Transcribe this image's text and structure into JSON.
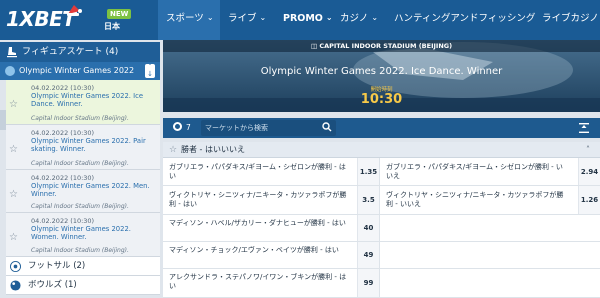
{
  "header": {
    "logo": "1XBET",
    "new_badge": "NEW",
    "language": "日本",
    "nav": [
      {
        "label": "スポーツ",
        "chevron": true
      },
      {
        "label": "ライブ",
        "chevron": true
      },
      {
        "label": "PROMO",
        "chevron": true
      },
      {
        "label": "カジノ",
        "chevron": true
      },
      {
        "label": "ハンティングアンドフィッシング",
        "chevron": false
      },
      {
        "label": "ライブカジノ",
        "chevron": true
      }
    ]
  },
  "sidebar": {
    "sport": {
      "label": "フィギュアスケート (4)"
    },
    "league": {
      "label": "Olympic Winter Games 2022"
    },
    "matches": [
      {
        "date": "04.02.2022 (10:30)",
        "title": "Olympic Winter Games 2022. Ice Dance. Winner.",
        "venue": "Capital Indoor Stadium (Beijing)."
      },
      {
        "date": "04.02.2022 (10:30)",
        "title": "Olympic Winter Games 2022. Pair skating. Winner.",
        "venue": "Capital Indoor Stadium (Beijing)."
      },
      {
        "date": "04.02.2022 (10:30)",
        "title": "Olympic Winter Games 2022. Men. Winner.",
        "venue": "Capital Indoor Stadium (Beijing)."
      },
      {
        "date": "04.02.2022 (10:30)",
        "title": "Olympic Winter Games 2022. Women. Winner.",
        "venue": "Capital Indoor Stadium (Beijing)."
      }
    ],
    "categories": [
      {
        "label": "フットサル (2)"
      },
      {
        "label": "ボウルズ (1)"
      }
    ]
  },
  "hero": {
    "stadium": "CAPITAL INDOOR STADIUM (BEIJING)",
    "title": "Olympic Winter Games 2022. Ice Dance. Winner",
    "start_label": "開始時刻",
    "start_time": "10:30"
  },
  "toolbar": {
    "market_count": "7",
    "search_placeholder": "マーケットから検索"
  },
  "market": {
    "group_label": "勝者 - はいいいえ",
    "rows": [
      {
        "left_name": "ガブリエラ・パパダキス/ギヨーム・シゼロンが勝利 - はい",
        "left_odd": "1.35",
        "right_name": "ガブリエラ・パパダキス/ギヨーム・シゼロンが勝利 - いいえ",
        "right_odd": "2.94"
      },
      {
        "left_name": "ヴィクトリヤ・シニツィナ/ニキータ・カツァラポフが勝利 - はい",
        "left_odd": "3.5",
        "right_name": "ヴィクトリヤ・シニツィナ/ニキータ・カツァラポフが勝利 - いいえ",
        "right_odd": "1.26"
      },
      {
        "left_name": "マディソン・ハベル/ザカリー・ダナヒューが勝利 - はい",
        "left_odd": "40",
        "right_name": "",
        "right_odd": ""
      },
      {
        "left_name": "マディソン・チョック/エヴァン・ベイツが勝利 - はい",
        "left_odd": "49",
        "right_name": "",
        "right_odd": ""
      },
      {
        "left_name": "アレクサンドラ・ステパノワ/イワン・ブキンが勝利 - はい",
        "left_odd": "99",
        "right_name": "",
        "right_odd": ""
      }
    ]
  },
  "colors": {
    "header": "#1a5b95",
    "accent_green": "#7dc242",
    "time_yellow": "#f7c948"
  }
}
